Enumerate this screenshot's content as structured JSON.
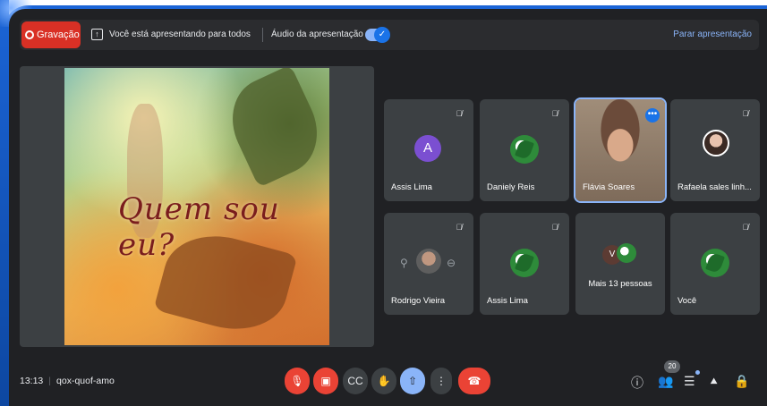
{
  "topbar": {
    "record_label": "Gravação",
    "presenting_text": "Você está apresentando para todos",
    "audio_label": "Áudio da apresentação",
    "stop_label": "Parar apresentação"
  },
  "slide": {
    "title": "Quem sou eu?"
  },
  "participants": [
    {
      "name": "Assis Lima",
      "avatar": "A"
    },
    {
      "name": "Daniely Reis"
    },
    {
      "name": "Flávia Soares"
    },
    {
      "name": "Rafaela sales linh..."
    },
    {
      "name": "Rodrigo Vieira"
    },
    {
      "name": "Assis Lima"
    },
    {
      "name": "Mais 13 pessoas",
      "avatar": "V"
    },
    {
      "name": "Você"
    }
  ],
  "bottombar": {
    "time": "13:13",
    "meeting_code": "qox-quof-amo",
    "participants_count": "20"
  },
  "colors": {
    "accent": "#1a73e8",
    "record": "#d93025",
    "hangup": "#ea4335"
  }
}
